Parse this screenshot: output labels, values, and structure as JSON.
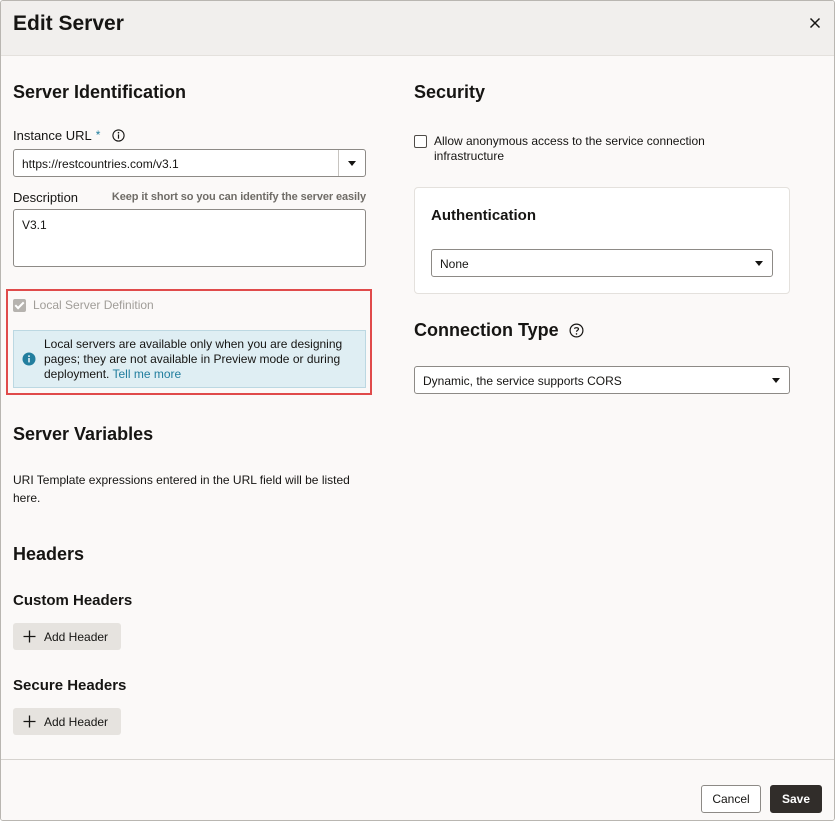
{
  "dialog": {
    "title": "Edit Server",
    "close_icon": "close-icon"
  },
  "server_identification": {
    "heading": "Server Identification",
    "instance_url": {
      "label": "Instance URL",
      "required_marker": "*",
      "value": "https://restcountries.com/v3.1"
    },
    "description": {
      "label": "Description",
      "hint": "Keep it short so you can identify the server easily",
      "value": "V3.1"
    },
    "local_server": {
      "label": "Local Server Definition",
      "checked": true,
      "disabled": true,
      "info_text": "Local servers are available only when you are designing pages; they are not available in Preview mode or during deployment.",
      "link_text": "Tell me more"
    }
  },
  "server_variables": {
    "heading": "Server Variables",
    "text": "URI Template expressions entered in the URL field will be listed here."
  },
  "headers": {
    "heading": "Headers",
    "custom": {
      "heading": "Custom Headers",
      "button_label": "Add Header"
    },
    "secure": {
      "heading": "Secure Headers",
      "button_label": "Add Header"
    }
  },
  "security": {
    "heading": "Security",
    "anonymous_label": "Allow anonymous access to the service connection infrastructure",
    "anonymous_checked": false,
    "authentication": {
      "heading": "Authentication",
      "selected": "None"
    }
  },
  "connection_type": {
    "heading": "Connection Type",
    "selected": "Dynamic, the service supports CORS"
  },
  "footer": {
    "cancel_label": "Cancel",
    "save_label": "Save"
  },
  "colors": {
    "accent": "#227e9e",
    "highlight": "#e04b4b",
    "primary_button": "#312d2a"
  }
}
